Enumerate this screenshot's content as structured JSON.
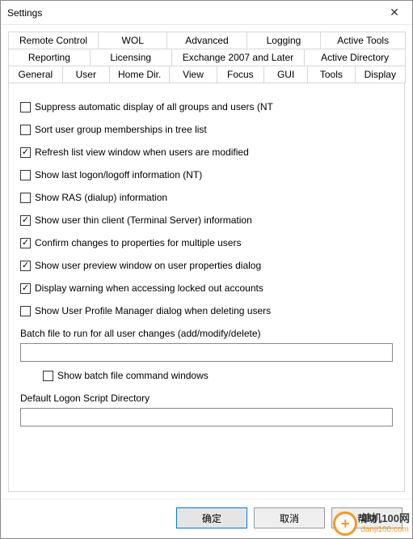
{
  "window": {
    "title": "Settings"
  },
  "tabs": {
    "row1": [
      "Remote Control",
      "WOL",
      "Advanced",
      "Logging",
      "Active Tools"
    ],
    "row2": [
      "Reporting",
      "Licensing",
      "Exchange 2007 and Later",
      "Active Directory"
    ],
    "row3": [
      "General",
      "User",
      "Home Dir.",
      "View",
      "Focus",
      "GUI",
      "Tools",
      "Display"
    ]
  },
  "active_tab": "User",
  "options": [
    {
      "label": "Suppress automatic display of all groups and users (NT",
      "checked": false
    },
    {
      "label": "Sort user group memberships in tree list",
      "checked": false
    },
    {
      "label": "Refresh list view window when users are modified",
      "checked": true
    },
    {
      "label": "Show last logon/logoff information (NT)",
      "checked": false
    },
    {
      "label": "Show RAS (dialup) information",
      "checked": false
    },
    {
      "label": "Show user thin client (Terminal Server) information",
      "checked": true
    },
    {
      "label": "Confirm changes to properties for multiple users",
      "checked": true
    },
    {
      "label": "Show user preview window on user properties dialog",
      "checked": true
    },
    {
      "label": "Display warning when accessing locked out accounts",
      "checked": true
    },
    {
      "label": "Show User Profile Manager dialog when deleting users",
      "checked": false
    }
  ],
  "batch": {
    "label": "Batch file to run for all user changes (add/modify/delete)",
    "value": "",
    "show_cmd": {
      "label": "Show batch file command windows",
      "checked": false
    }
  },
  "logon_script": {
    "label": "Default Logon Script Directory",
    "value": ""
  },
  "buttons": {
    "ok": "确定",
    "cancel": "取消",
    "help": "帮助"
  },
  "watermark": {
    "brand": "单机100网",
    "url": "danji100.com"
  }
}
